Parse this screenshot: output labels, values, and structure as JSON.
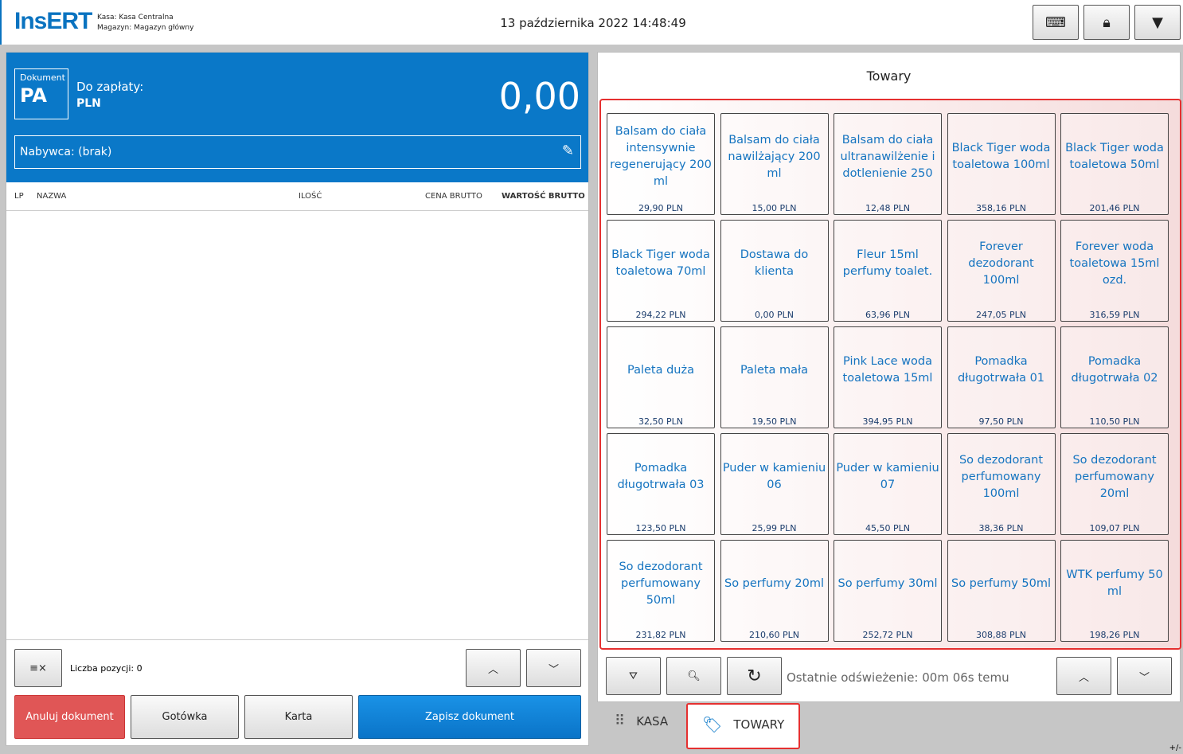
{
  "header": {
    "logo": "InsERT",
    "kasa": "Kasa:  Kasa Centralna",
    "magazyn": "Magazyn:  Magazyn główny",
    "datetime": "13 października 2022 14:48:49"
  },
  "document": {
    "label": "Dokument",
    "type": "PA",
    "to_pay": "Do zapłaty:",
    "currency": "PLN",
    "amount": "0,00",
    "buyer": "Nabywca: (brak)"
  },
  "table": {
    "columns": [
      "LP",
      "NAZWA",
      "ILOŚĆ",
      "CENA BRUTTO",
      "WARTOŚĆ BRUTTO"
    ]
  },
  "footer_left": {
    "count": "Liczba pozycji: 0",
    "cancel": "Anuluj dokument",
    "cash": "Gotówka",
    "card": "Karta",
    "save": "Zapisz dokument"
  },
  "products": {
    "title": "Towary",
    "refresh": "Ostatnie odświeżenie: 00m 06s temu",
    "items": [
      {
        "name": "Balsam do ciała intensywnie regenerujący 200 ml",
        "price": "29,90 PLN"
      },
      {
        "name": "Balsam do ciała nawilżający 200 ml",
        "price": "15,00 PLN"
      },
      {
        "name": "Balsam do ciała ultranawilżenie i dotlenienie 250",
        "price": "12,48 PLN"
      },
      {
        "name": "Black Tiger woda toaletowa 100ml",
        "price": "358,16 PLN"
      },
      {
        "name": "Black Tiger woda toaletowa 50ml",
        "price": "201,46 PLN"
      },
      {
        "name": "Black Tiger woda toaletowa 70ml",
        "price": "294,22 PLN"
      },
      {
        "name": "Dostawa do klienta",
        "price": "0,00 PLN"
      },
      {
        "name": "Fleur 15ml perfumy toalet.",
        "price": "63,96 PLN"
      },
      {
        "name": "Forever dezodorant 100ml",
        "price": "247,05 PLN"
      },
      {
        "name": "Forever woda toaletowa 15ml ozd.",
        "price": "316,59 PLN"
      },
      {
        "name": "Paleta duża",
        "price": "32,50 PLN"
      },
      {
        "name": "Paleta mała",
        "price": "19,50 PLN"
      },
      {
        "name": "Pink Lace woda toaletowa 15ml",
        "price": "394,95 PLN"
      },
      {
        "name": "Pomadka długotrwała 01",
        "price": "97,50 PLN"
      },
      {
        "name": "Pomadka długotrwała 02",
        "price": "110,50 PLN"
      },
      {
        "name": "Pomadka długotrwała 03",
        "price": "123,50 PLN"
      },
      {
        "name": "Puder w kamieniu 06",
        "price": "25,99 PLN"
      },
      {
        "name": "Puder w kamieniu 07",
        "price": "45,50 PLN"
      },
      {
        "name": "So dezodorant perfumowany 100ml",
        "price": "38,36 PLN"
      },
      {
        "name": "So dezodorant perfumowany 20ml",
        "price": "109,07 PLN"
      },
      {
        "name": "So dezodorant perfumowany 50ml",
        "price": "231,82 PLN"
      },
      {
        "name": "So perfumy 20ml",
        "price": "210,60 PLN"
      },
      {
        "name": "So perfumy 30ml",
        "price": "252,72 PLN"
      },
      {
        "name": "So perfumy 50ml",
        "price": "308,88 PLN"
      },
      {
        "name": "WTK perfumy 50 ml",
        "price": "198,26 PLN"
      }
    ]
  },
  "tabs": {
    "kasa": "KASA",
    "towary": "TOWARY"
  },
  "corner": "+/-"
}
